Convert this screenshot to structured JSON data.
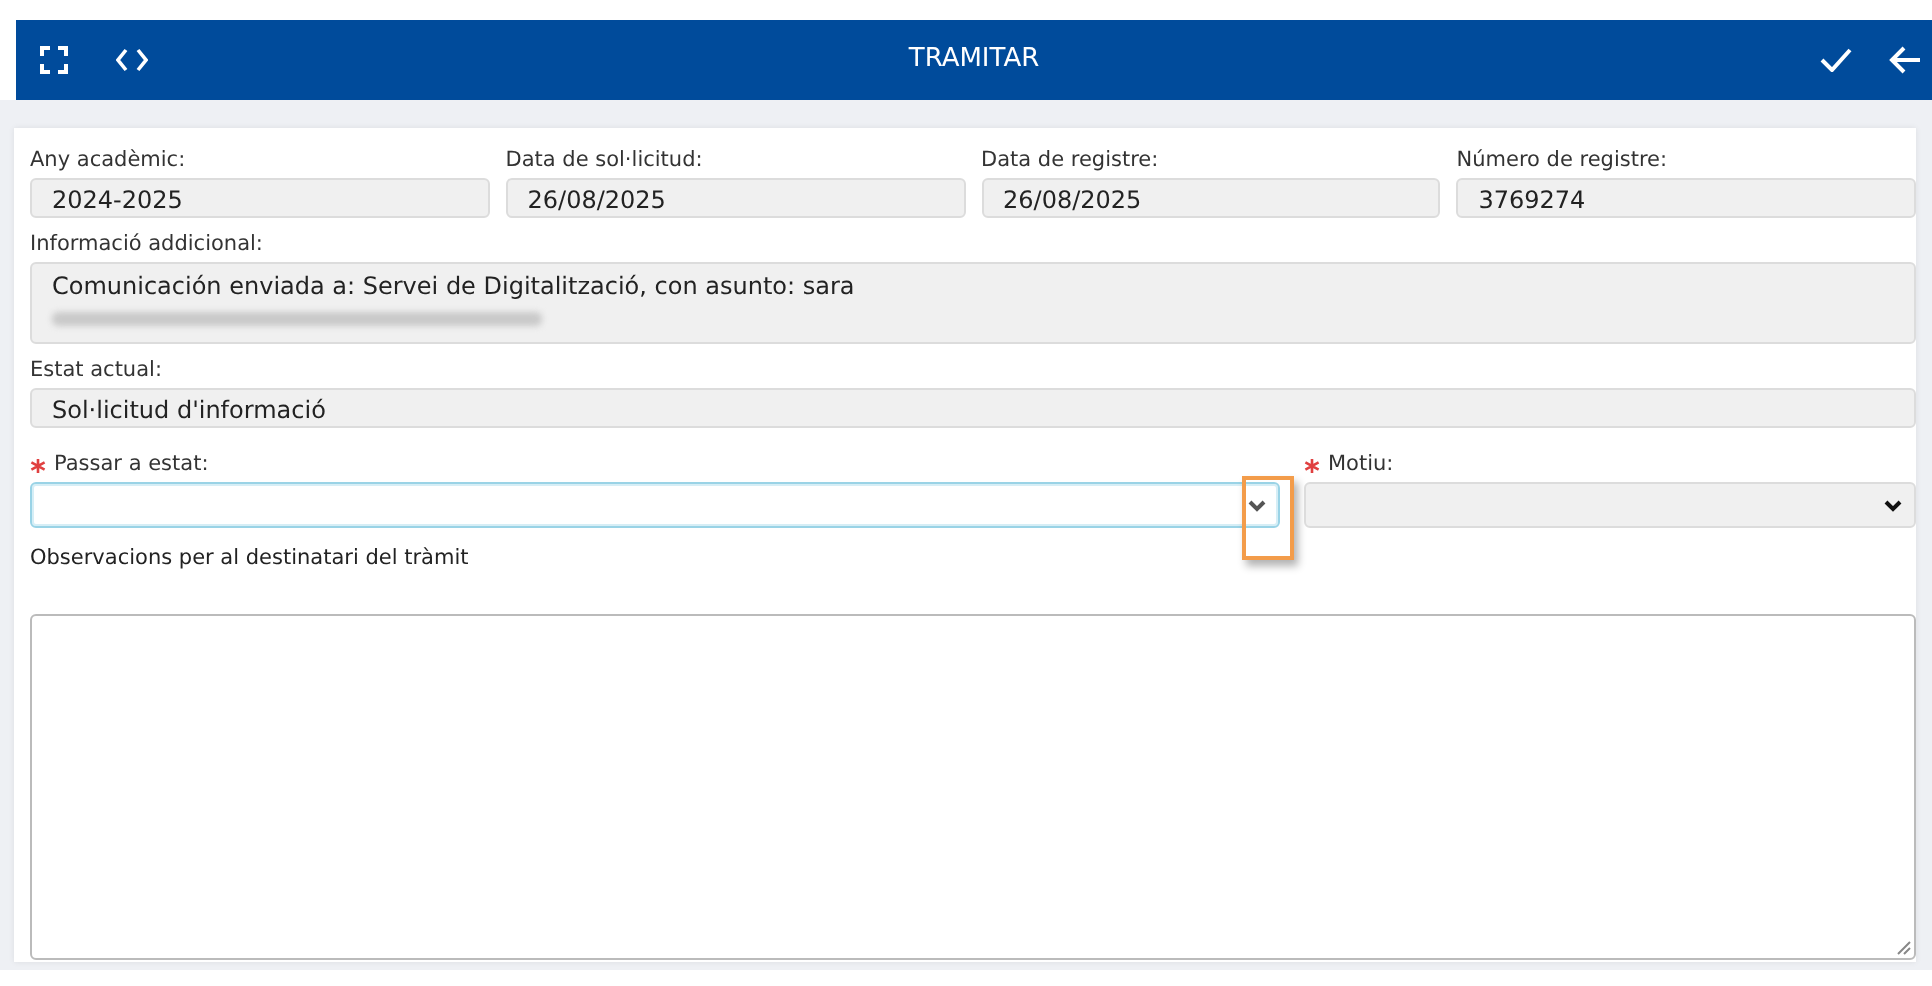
{
  "header": {
    "title": "TRAMITAR"
  },
  "top_fields": [
    {
      "label": "Any acadèmic:",
      "value": "2024-2025"
    },
    {
      "label": "Data de sol·licitud:",
      "value": "26/08/2025"
    },
    {
      "label": "Data de registre:",
      "value": "26/08/2025"
    },
    {
      "label": "Número de registre:",
      "value": "3769274"
    }
  ],
  "additional_info": {
    "label": "Informació addicional:",
    "value": "Comunicación enviada a: Servei de Digitalització, con asunto: sara",
    "redacted_line": true
  },
  "current_state": {
    "label": "Estat actual:",
    "value": "Sol·licitud d'informació"
  },
  "selects": [
    {
      "label": "Passar a estat:",
      "required": true,
      "focused": true,
      "disabled": false,
      "highlighted": true
    },
    {
      "label": "Motiu:",
      "required": true,
      "focused": false,
      "disabled": true,
      "highlighted": false
    }
  ],
  "observations": {
    "label": "Observacions per al destinatari del tràmit"
  }
}
